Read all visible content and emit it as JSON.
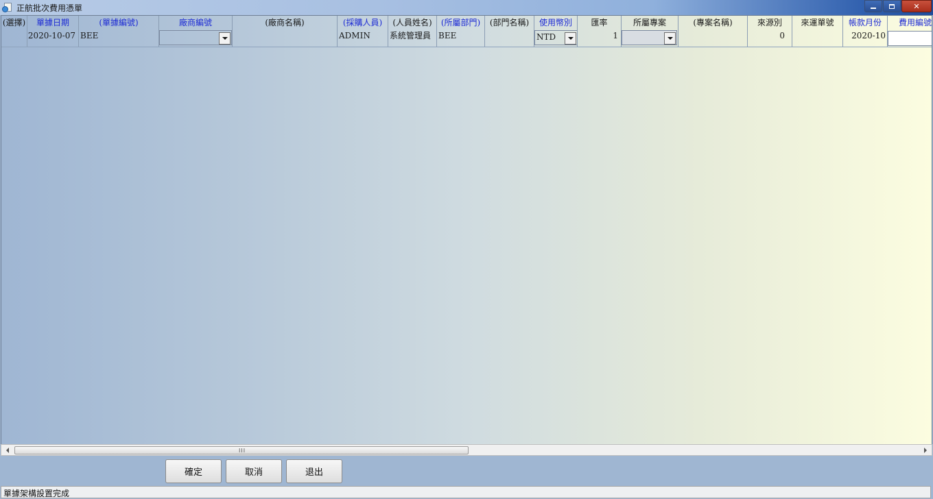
{
  "window": {
    "title": "正航批次費用憑單",
    "minimize_icon": "minimize-icon",
    "restore_icon": "restore-icon",
    "close_icon": "close-icon"
  },
  "grid": {
    "headers": [
      {
        "label": "(選擇)",
        "required": false
      },
      {
        "label": "單據日期",
        "required": true
      },
      {
        "label": "(單據編號)",
        "required": true
      },
      {
        "label": "廠商編號",
        "required": true
      },
      {
        "label": "(廠商名稱)",
        "required": false
      },
      {
        "label": "(採購人員)",
        "required": true
      },
      {
        "label": "(人員姓名)",
        "required": false
      },
      {
        "label": "(所屬部門)",
        "required": true
      },
      {
        "label": "(部門名稱)",
        "required": false
      },
      {
        "label": "使用幣別",
        "required": true
      },
      {
        "label": "匯率",
        "required": false
      },
      {
        "label": "所屬專案",
        "required": false
      },
      {
        "label": "(專案名稱)",
        "required": false
      },
      {
        "label": "來源別",
        "required": false
      },
      {
        "label": "來運單號",
        "required": false
      },
      {
        "label": "帳款月份",
        "required": true
      },
      {
        "label": "費用編號",
        "required": true
      }
    ],
    "row": {
      "select": "",
      "date": "2020-10-07",
      "doc_no": "BEE",
      "vendor_no": "",
      "vendor_name": "",
      "buyer": "ADMIN",
      "person_name": "系統管理員",
      "department": "BEE",
      "department_name": "",
      "currency": "NTD",
      "exchange_rate": "1",
      "project": "",
      "project_name": "",
      "source_type": "0",
      "shipping_no": "",
      "account_month": "2020-10",
      "expense_no": ""
    }
  },
  "scrollbar": {
    "grip": "III"
  },
  "buttons": {
    "confirm": "確定",
    "cancel": "取消",
    "exit": "退出"
  },
  "status": {
    "text": "單據架構設置完成"
  },
  "colors": {
    "required_header": "#1d2bd4",
    "title_bar_dark": "#1e4c9c",
    "close_button": "#c8503c"
  }
}
